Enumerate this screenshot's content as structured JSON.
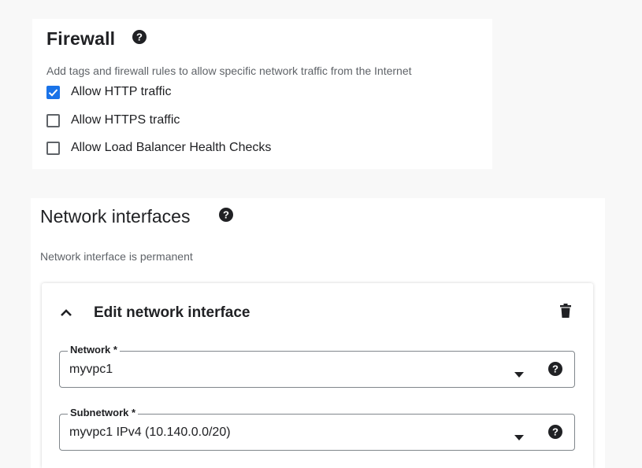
{
  "firewall": {
    "title": "Firewall",
    "description": "Add tags and firewall rules to allow specific network traffic from the Internet",
    "options": [
      {
        "label": "Allow HTTP traffic",
        "checked": true
      },
      {
        "label": "Allow HTTPS traffic",
        "checked": false
      },
      {
        "label": "Allow Load Balancer Health Checks",
        "checked": false
      }
    ]
  },
  "network_interfaces": {
    "title": "Network interfaces",
    "subtitle": "Network interface is permanent",
    "edit_card": {
      "title": "Edit network interface",
      "fields": [
        {
          "label": "Network *",
          "value": "myvpc1"
        },
        {
          "label": "Subnetwork *",
          "value": "myvpc1 IPv4 (10.140.0.0/20)"
        }
      ]
    }
  },
  "colors": {
    "accent": "#1a73e8",
    "text": "#202124",
    "secondary_text": "#5f6368",
    "border": "#80868b"
  },
  "icons": [
    "help-icon",
    "checkmark-icon",
    "chevron-up-icon",
    "trash-icon",
    "dropdown-arrow-icon"
  ]
}
